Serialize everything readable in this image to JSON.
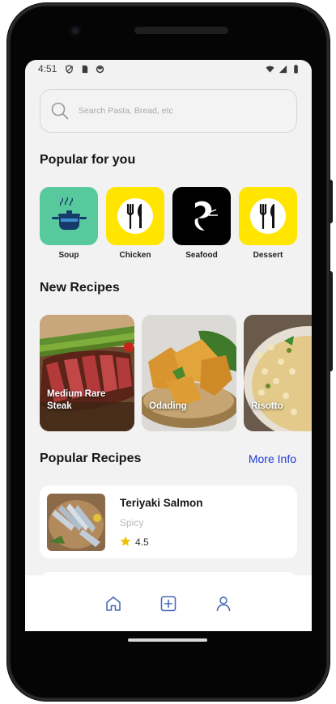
{
  "status_bar": {
    "time": "4:51",
    "left_icons": [
      "shield-icon",
      "sim-card-icon",
      "circle-icon"
    ],
    "right_icons": [
      "wifi-icon",
      "signal-icon",
      "battery-icon"
    ]
  },
  "search": {
    "placeholder": "Search Pasta, Bread, etc",
    "value": ""
  },
  "popular_for_you": {
    "title": "Popular for you",
    "categories": [
      {
        "label": "Soup",
        "icon": "pot-icon",
        "color": "#57c99d"
      },
      {
        "label": "Chicken",
        "icon": "fork-knife-icon",
        "color": "#ffe500"
      },
      {
        "label": "Seafood",
        "icon": "fish-icon",
        "color": "#000000"
      },
      {
        "label": "Dessert",
        "icon": "fork-knife-icon",
        "color": "#ffe500"
      }
    ]
  },
  "new_recipes": {
    "title": "New Recipes",
    "items": [
      {
        "name": "Medium Rare Steak",
        "image": "steak-photo"
      },
      {
        "name": "Odading",
        "image": "fried-bread-photo"
      },
      {
        "name": "Risotto",
        "image": "risotto-photo"
      }
    ]
  },
  "popular_recipes": {
    "title": "Popular Recipes",
    "more_label": "More Info",
    "items": [
      {
        "name": "Teriyaki Salmon",
        "tag": "Spicy",
        "rating": "4.5",
        "image": "fish-platter-photo"
      }
    ]
  },
  "bottom_nav": {
    "items": [
      "home-icon",
      "add-icon",
      "profile-icon"
    ]
  },
  "colors": {
    "accent_link": "#1a3cd8",
    "nav_icon": "#4b6cb7",
    "star": "#f2c200",
    "screen_bg": "#f2f2f2"
  }
}
